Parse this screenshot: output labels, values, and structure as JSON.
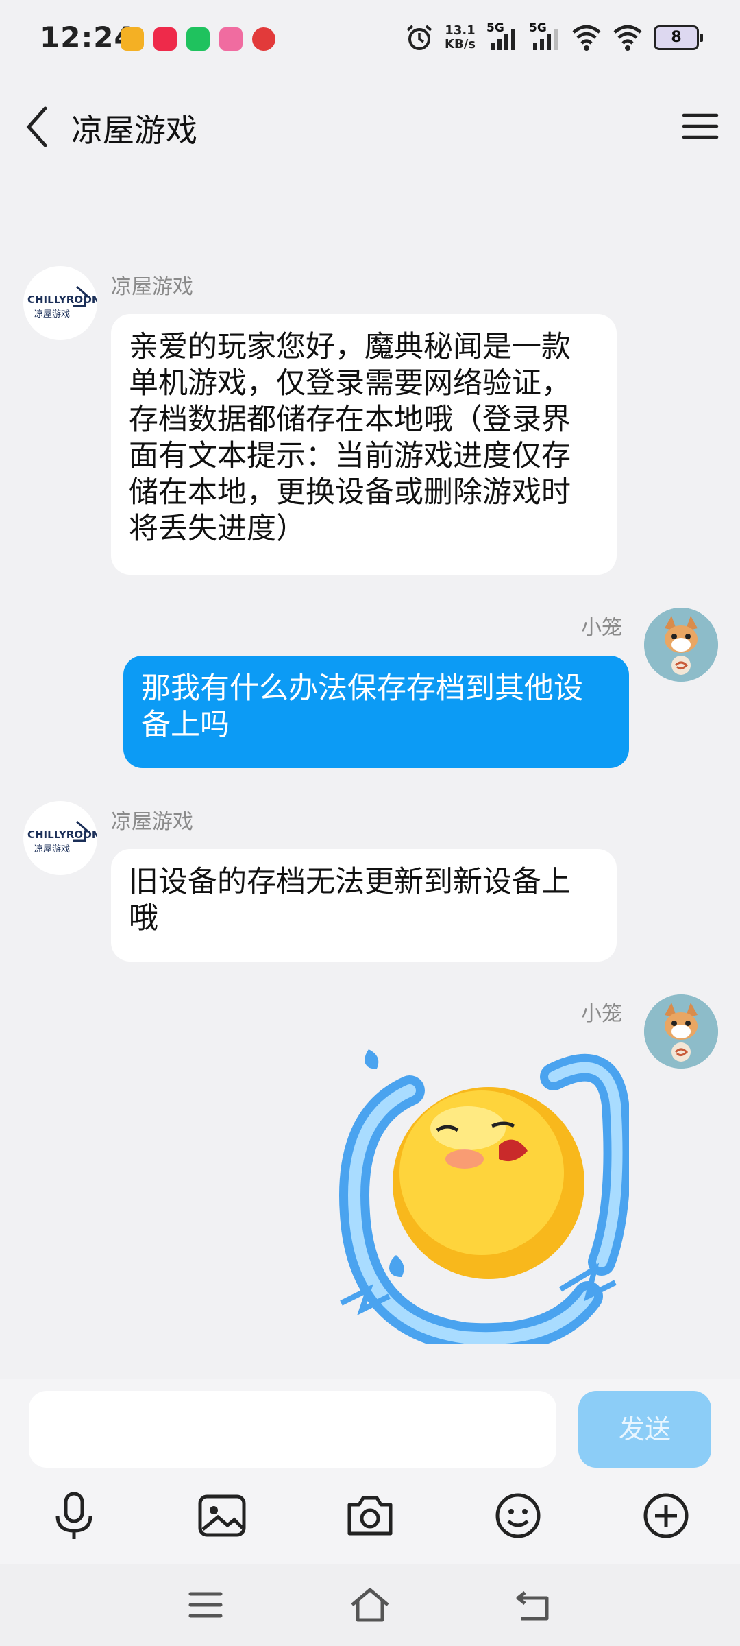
{
  "status_bar": {
    "time": "12:24",
    "net_speed_value": "13.1",
    "net_speed_unit": "KB/s",
    "sim1_label": "5G",
    "sim2_label": "5G",
    "battery": "8",
    "app_icons": [
      "notes-icon",
      "xiaohongshu-icon",
      "wechat-icon",
      "bilibili-icon",
      "china-merchants-bank-icon"
    ]
  },
  "header": {
    "title": "凉屋游戏"
  },
  "messages": [
    {
      "sender": "凉屋游戏",
      "side": "left",
      "text": "亲爱的玩家您好，魔典秘闻是一款单机游戏，仅登录需要网络验证，存档数据都储存在本地哦（登录界面有文本提示：当前游戏进度仅存储在本地，更换设备或删除游戏时将丢失进度）"
    },
    {
      "sender": "小笼",
      "side": "right",
      "text": "那我有什么办法保存存档到其他设备上吗"
    },
    {
      "sender": "凉屋游戏",
      "side": "left",
      "text": "旧设备的存档无法更新到新设备上哦"
    },
    {
      "sender": "小笼",
      "side": "right",
      "sticker": "crying-emoji-sticker"
    }
  ],
  "logo": {
    "line1": "CHILLYROOM",
    "line2": "凉屋游戏"
  },
  "input": {
    "value": "",
    "send_label": "发送"
  },
  "toolbar": [
    "microphone-icon",
    "image-icon",
    "camera-icon",
    "emoji-icon",
    "plus-icon"
  ],
  "colors": {
    "bubble_self": "#0c9bf5",
    "send_button": "#8ccdf7",
    "background": "#f1f1f3"
  }
}
